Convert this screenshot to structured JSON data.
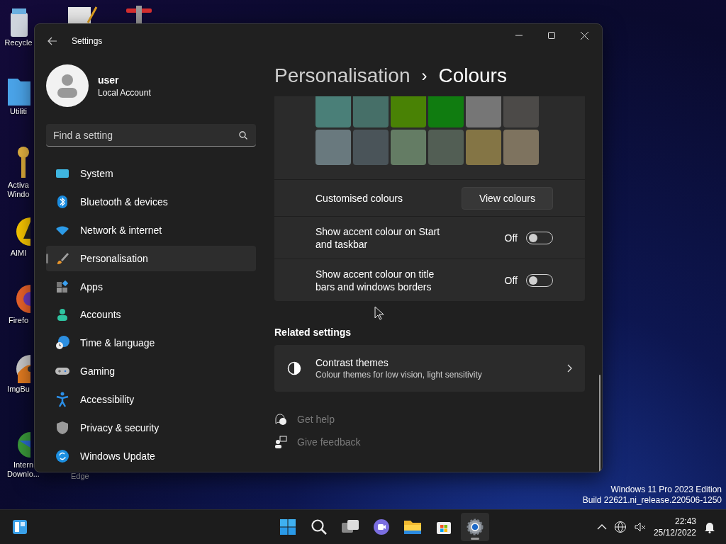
{
  "desktop_icons": [
    {
      "label": "Recycle"
    },
    {
      "label": "Utiliti"
    },
    {
      "label": "Activa Windo"
    },
    {
      "label": "AIMI"
    },
    {
      "label": "Firefo"
    },
    {
      "label": "ImgBu"
    },
    {
      "label": "Intern Downlo..."
    }
  ],
  "desktop_text": {
    "edge_label": "Edge",
    "edition": "Windows 11 Pro 2023 Edition",
    "build": "Build 22621.ni_release.220506-1250"
  },
  "window": {
    "title": "Settings"
  },
  "account": {
    "name": "user",
    "type": "Local Account"
  },
  "search": {
    "placeholder": "Find a setting"
  },
  "sidebar": {
    "items": [
      {
        "label": "System",
        "selected": false
      },
      {
        "label": "Bluetooth & devices",
        "selected": false
      },
      {
        "label": "Network & internet",
        "selected": false
      },
      {
        "label": "Personalisation",
        "selected": true
      },
      {
        "label": "Apps",
        "selected": false
      },
      {
        "label": "Accounts",
        "selected": false
      },
      {
        "label": "Time & language",
        "selected": false
      },
      {
        "label": "Gaming",
        "selected": false
      },
      {
        "label": "Accessibility",
        "selected": false
      },
      {
        "label": "Privacy & security",
        "selected": false
      },
      {
        "label": "Windows Update",
        "selected": false
      }
    ]
  },
  "breadcrumb": {
    "parent": "Personalisation",
    "separator": "›",
    "current": "Colours"
  },
  "swatches": [
    {
      "color": "#4a7f78"
    },
    {
      "color": "#466f68"
    },
    {
      "color": "#498205"
    },
    {
      "color": "#107c10"
    },
    {
      "color": "#767676"
    },
    {
      "color": "#4c4a48"
    },
    {
      "color": "#69797e"
    },
    {
      "color": "#4a5459"
    },
    {
      "color": "#647c64"
    },
    {
      "color": "#525e54"
    },
    {
      "color": "#847545"
    },
    {
      "color": "#7e735f"
    }
  ],
  "rows": [
    {
      "kind": "button",
      "label": "Customised colours",
      "button": "View colours"
    },
    {
      "kind": "toggle",
      "label": "Show accent colour on Start and taskbar",
      "state_text": "Off",
      "on": false
    },
    {
      "kind": "toggle",
      "label": "Show accent colour on title bars and windows borders",
      "state_text": "Off",
      "on": false
    }
  ],
  "related": {
    "heading": "Related settings",
    "title": "Contrast themes",
    "subtitle": "Colour themes for low vision, light sensitivity"
  },
  "links": [
    {
      "label": "Get help"
    },
    {
      "label": "Give feedback"
    }
  ],
  "taskbar": {
    "time": "22:43",
    "date": "25/12/2022",
    "apps": [
      {
        "selected": false
      },
      {
        "selected": false
      },
      {
        "selected": false
      },
      {
        "selected": false
      },
      {
        "selected": false
      },
      {
        "selected": false
      },
      {
        "selected": true
      }
    ]
  }
}
